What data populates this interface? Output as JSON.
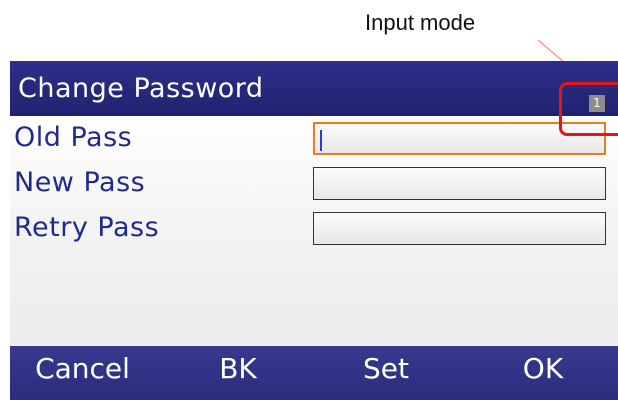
{
  "annotation": {
    "callout_label": "Input mode"
  },
  "window": {
    "title": "Change Password",
    "input_mode_indicator": "1"
  },
  "form": {
    "fields": [
      {
        "label": "Old Pass",
        "value": ""
      },
      {
        "label": "New Pass",
        "value": ""
      },
      {
        "label": "Retry Pass",
        "value": ""
      }
    ]
  },
  "softkeys": [
    "Cancel",
    "BK",
    "Set",
    "OK"
  ],
  "colors": {
    "titlebar": "#2e2f8a",
    "label_text": "#202a8a",
    "focus_border": "#e77d22",
    "callout_highlight": "#e8131b"
  }
}
